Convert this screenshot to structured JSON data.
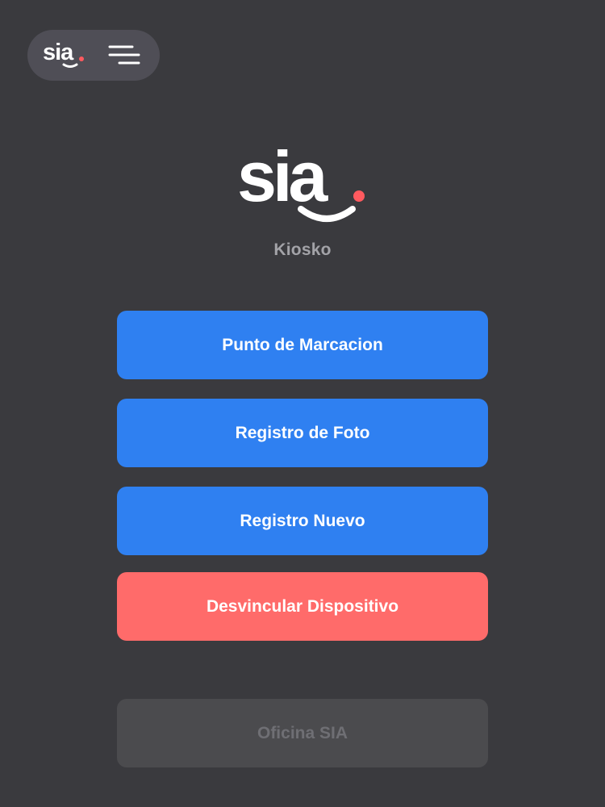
{
  "header": {
    "logo_text": "sia",
    "menu_icon": "hamburger-menu-icon"
  },
  "brand": {
    "logo_text": "sia",
    "subtitle": "Kiosko"
  },
  "actions": {
    "punto_marcacion": "Punto de Marcacion",
    "registro_foto": "Registro de Foto",
    "registro_nuevo": "Registro Nuevo",
    "desvincular": "Desvincular Dispositivo",
    "oficina": "Oficina SIA"
  },
  "colors": {
    "background": "#3a3a3e",
    "pill": "#4f4e56",
    "primary": "#2f80f1",
    "danger": "#ff6b6a",
    "disabled": "#4b4b4e",
    "disabled_text": "#6f6f74",
    "accent_dot": "#ff5a5f"
  }
}
